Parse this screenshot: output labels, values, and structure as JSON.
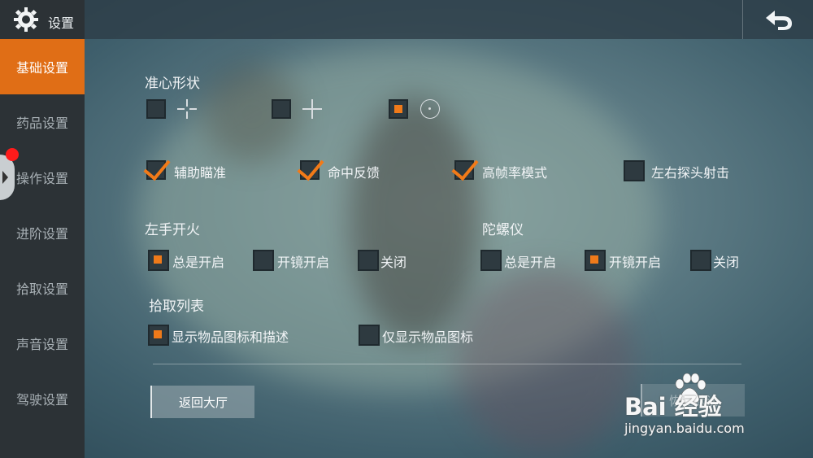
{
  "header": {
    "title": "设置",
    "title_icon": "gear-icon",
    "back_icon": "return-icon"
  },
  "sidebar": {
    "items": [
      {
        "label": "基础设置",
        "active": true
      },
      {
        "label": "药品设置"
      },
      {
        "label": "操作设置"
      },
      {
        "label": "进阶设置"
      },
      {
        "label": "拾取设置"
      },
      {
        "label": "声音设置"
      },
      {
        "label": "驾驶设置"
      }
    ]
  },
  "crosshair": {
    "heading": "准心形状",
    "options": [
      {
        "icon": "crosshair-gap-icon",
        "selected": false
      },
      {
        "icon": "crosshair-plus-icon",
        "selected": false
      },
      {
        "icon": "circle-dot-icon",
        "selected": true
      }
    ]
  },
  "toggles": [
    {
      "label": "辅助瞄准",
      "checked": true
    },
    {
      "label": "命中反馈",
      "checked": true
    },
    {
      "label": "高帧率模式",
      "checked": true
    },
    {
      "label": "左右探头射击",
      "checked": false
    }
  ],
  "left_fire": {
    "heading": "左手开火",
    "options": [
      {
        "label": "总是开启",
        "selected": true
      },
      {
        "label": "开镜开启",
        "selected": false
      },
      {
        "label": "关闭",
        "selected": false
      }
    ]
  },
  "gyroscope": {
    "heading": "陀螺仪",
    "options": [
      {
        "label": "总是开启",
        "selected": false
      },
      {
        "label": "开镜开启",
        "selected": true
      },
      {
        "label": "关闭",
        "selected": false
      }
    ]
  },
  "pickup_list": {
    "heading": "拾取列表",
    "options": [
      {
        "label": "显示物品图标和描述",
        "selected": true
      },
      {
        "label": "仅显示物品图标",
        "selected": false
      }
    ]
  },
  "buttons": {
    "return_lobby": "返回大厅",
    "restore_default": "恢复默认"
  },
  "watermark": {
    "main": "Bai 经验",
    "sub": "jingyan.baidu.com"
  },
  "colors": {
    "accent": "#e06e16",
    "sidebar": "#2c3236"
  }
}
